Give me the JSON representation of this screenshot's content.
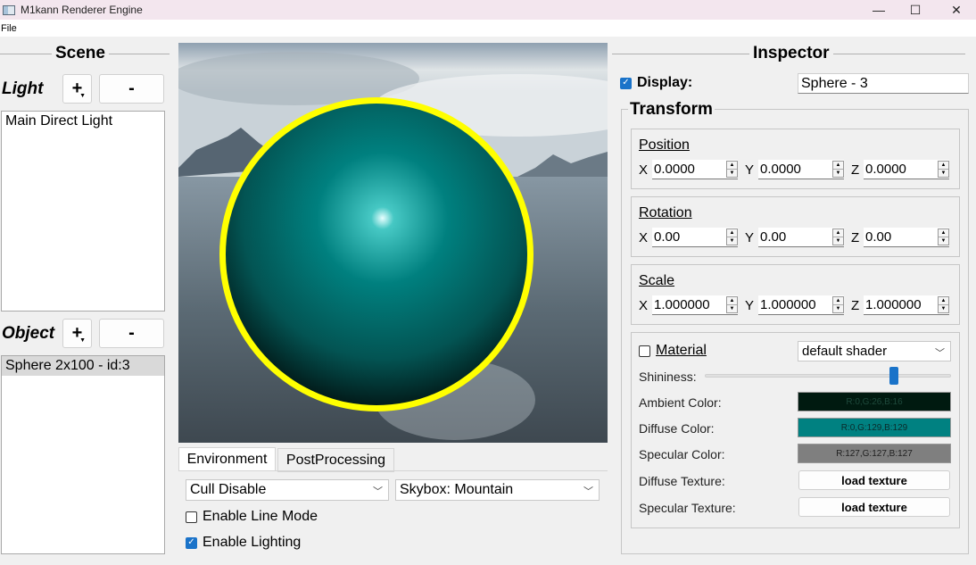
{
  "window": {
    "title": "M1kann Renderer Engine",
    "minimize": "—",
    "maximize": "☐",
    "close": "✕"
  },
  "menu": {
    "file": "File"
  },
  "scene": {
    "title": "Scene",
    "light_label": "Light",
    "object_label": "Object",
    "add": "+",
    "remove": "-",
    "lights": [
      "Main Direct Light"
    ],
    "objects": [
      "Sphere 2x100 - id:3"
    ]
  },
  "viewport": {
    "sphere_color": "#00807f",
    "outline_color": "#ffff00"
  },
  "environment": {
    "tabs": [
      "Environment",
      "PostProcessing"
    ],
    "cull_mode": "Cull Disable",
    "skybox": "Skybox: Mountain",
    "line_mode_label": "Enable Line Mode",
    "line_mode": false,
    "lighting_label": "Enable Lighting",
    "lighting": true
  },
  "inspector": {
    "title": "Inspector",
    "display_label": "Display:",
    "display_checked": true,
    "name": "Sphere - 3",
    "transform_title": "Transform",
    "position": {
      "label": "Position",
      "x": "0.0000",
      "y": "0.0000",
      "z": "0.0000"
    },
    "rotation": {
      "label": "Rotation",
      "x": "0.00",
      "y": "0.00",
      "z": "0.00"
    },
    "scale": {
      "label": "Scale",
      "x": "1.000000",
      "y": "1.000000",
      "z": "1.000000"
    },
    "axes": {
      "x": "X",
      "y": "Y",
      "z": "Z"
    },
    "material": {
      "label": "Material",
      "checked": false,
      "shader": "default shader",
      "shininess_label": "Shininess:",
      "shininess": 0.78,
      "ambient_label": "Ambient Color:",
      "ambient_text": "R:0,G:26,B:16",
      "ambient_color": "#001a10",
      "diffuse_label": "Diffuse Color:",
      "diffuse_text": "R:0,G:129,B:129",
      "diffuse_color": "#008181",
      "specular_label": "Specular Color:",
      "specular_text": "R:127,G:127,B:127",
      "specular_color": "#7f7f7f",
      "diffuse_texture_label": "Diffuse Texture:",
      "specular_texture_label": "Specular Texture:",
      "load_texture": "load texture"
    }
  }
}
